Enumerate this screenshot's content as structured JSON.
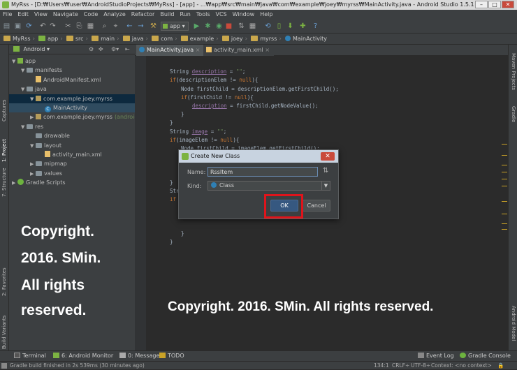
{
  "window": {
    "title": "MyRss - [D:₩Users₩user₩AndroidStudioProjects₩MyRss] - [app] - ...₩app₩src₩main₩java₩com₩example₩joey₩myrss₩MainActivity.java - Android Studio 1.5.1"
  },
  "menu": [
    "File",
    "Edit",
    "View",
    "Navigate",
    "Code",
    "Analyze",
    "Refactor",
    "Build",
    "Run",
    "Tools",
    "VCS",
    "Window",
    "Help"
  ],
  "toolbar": {
    "run_config": "app"
  },
  "breadcrumb": [
    "MyRss",
    "app",
    "src",
    "main",
    "java",
    "com",
    "example",
    "joey",
    "myrss",
    "MainActivity"
  ],
  "project_panel": {
    "view_mode": "Android",
    "tree": [
      {
        "label": "app",
        "icon": "app",
        "arrow": "▼",
        "indent": 0
      },
      {
        "label": "manifests",
        "icon": "fold",
        "arrow": "▼",
        "indent": 1
      },
      {
        "label": "AndroidManifest.xml",
        "icon": "xml",
        "arrow": "",
        "indent": 2
      },
      {
        "label": "java",
        "icon": "fold",
        "arrow": "▼",
        "indent": 1
      },
      {
        "label": "com.example.joey.myrss",
        "icon": "pkg",
        "arrow": "▼",
        "indent": 2
      },
      {
        "label": "MainActivity",
        "icon": "cls",
        "arrow": "",
        "indent": 3
      },
      {
        "label": "com.example.joey.myrss",
        "suffix": "(androidTest)",
        "icon": "pkg",
        "arrow": "▶",
        "indent": 2
      },
      {
        "label": "res",
        "icon": "fold",
        "arrow": "▼",
        "indent": 1
      },
      {
        "label": "drawable",
        "icon": "fold",
        "arrow": "",
        "indent": 2
      },
      {
        "label": "layout",
        "icon": "fold",
        "arrow": "▼",
        "indent": 2
      },
      {
        "label": "activity_main.xml",
        "icon": "xml",
        "arrow": "",
        "indent": 3
      },
      {
        "label": "mipmap",
        "icon": "fold",
        "arrow": "▶",
        "indent": 2
      },
      {
        "label": "values",
        "icon": "fold",
        "arrow": "▶",
        "indent": 2
      },
      {
        "label": "Gradle Scripts",
        "icon": "grd",
        "arrow": "▶",
        "indent": 0
      }
    ]
  },
  "editor_tabs": [
    {
      "label": "MainActivity.java",
      "active": true
    },
    {
      "label": "activity_main.xml",
      "active": false
    }
  ],
  "code_lines": [
    {
      "row": 1,
      "indent": 0,
      "html": "String <span class='fld'>description</span> = <span class='str'>\"\"</span>;"
    },
    {
      "row": 2,
      "indent": 0,
      "html": "<span class='kw'>if</span>(descriptionElem != <span class='kw'>null</span>){"
    },
    {
      "row": 3,
      "indent": 1,
      "html": "Node firstChild = descriptionElem.getFirstChild();"
    },
    {
      "row": 4,
      "indent": 1,
      "html": "<span class='kw'>if</span>(firstChild != <span class='kw'>null</span>){"
    },
    {
      "row": 5,
      "indent": 2,
      "html": "<span class='fld'>description</span> = firstChild.getNodeValue();"
    },
    {
      "row": 6,
      "indent": 1,
      "html": "}"
    },
    {
      "row": 7,
      "indent": 0,
      "html": "}"
    },
    {
      "row": 8,
      "indent": 0,
      "html": "String <span class='fld'>image</span> = <span class='str'>\"\"</span>;"
    },
    {
      "row": 9,
      "indent": 0,
      "html": "<span class='kw'>if</span>(imageElem != <span class='kw'>null</span>){"
    },
    {
      "row": 10,
      "indent": 1,
      "html": "Node firstChild = imageElem.getFirstChild();"
    },
    {
      "row": 14,
      "indent": 0,
      "html": "}"
    },
    {
      "row": 15,
      "indent": 0,
      "html": "Str"
    },
    {
      "row": 16,
      "indent": 0,
      "html": "<span class='kw'>if</span>"
    },
    {
      "row": 20,
      "indent": 1,
      "html": "}"
    },
    {
      "row": 21,
      "indent": 0,
      "html": "}"
    },
    {
      "row": 34,
      "indent": -1,
      "html": "}"
    }
  ],
  "dialog": {
    "title": "Create New Class",
    "name_label": "Name:",
    "name_value": "RssItem",
    "kind_label": "Kind:",
    "kind_value": "Class",
    "ok_label": "OK",
    "cancel_label": "Cancel"
  },
  "left_tool_tabs": [
    "Captures",
    "1: Project",
    "7: Structure",
    "2: Favorites",
    "Build Variants"
  ],
  "right_tool_tabs": [
    "Maven Projects",
    "Gradle",
    "Android Model"
  ],
  "bottom_tabs": [
    "Terminal",
    "6: Android Monitor",
    "0: Messages",
    "TODO",
    "Event Log",
    "Gradle Console"
  ],
  "status": {
    "message": "Gradle build finished in 2s 539ms (30 minutes ago)",
    "position": "134:1",
    "line_sep": "CRLF÷",
    "encoding": "UTF-8÷",
    "context": "Context: <no context>"
  },
  "watermark": {
    "left_lines": [
      "Copyright.",
      "2016. SMin.",
      "All rights",
      "reserved."
    ],
    "bottom": "Copyright. 2016. SMin. All rights reserved."
  },
  "colors": {
    "highlight": "#e0141b",
    "accent": "#365880"
  }
}
